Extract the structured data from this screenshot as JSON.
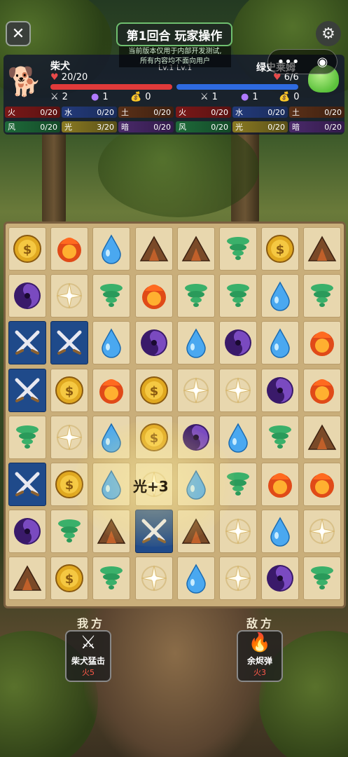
{
  "header": {
    "title": "第1回合 玩家操作",
    "notice_line1": "当前版本仅用于内部开发测试,",
    "notice_line2": "所有内容均不面向用户"
  },
  "player": {
    "name": "柴犬",
    "level": "Lv.1",
    "hp": "20/20",
    "hp_fraction": 1.0,
    "attack": "2",
    "magic": "1",
    "gold": "0",
    "elements": [
      {
        "name": "火",
        "value": "0/20",
        "cls": "e-fire"
      },
      {
        "name": "水",
        "value": "0/20",
        "cls": "e-water"
      },
      {
        "name": "土",
        "value": "0/20",
        "cls": "e-earth"
      },
      {
        "name": "风",
        "value": "0/20",
        "cls": "e-wind"
      },
      {
        "name": "光",
        "value": "3/20",
        "cls": "e-light"
      },
      {
        "name": "暗",
        "value": "0/20",
        "cls": "e-dark"
      }
    ]
  },
  "enemy": {
    "name": "绿史莱姆",
    "level": "Lv.1",
    "hp": "6/6",
    "hp_fraction": 1.0,
    "attack": "1",
    "magic": "1",
    "gold": "0",
    "elements": [
      {
        "name": "火",
        "value": "0/20",
        "cls": "e-fire"
      },
      {
        "name": "水",
        "value": "0/20",
        "cls": "e-water"
      },
      {
        "name": "土",
        "value": "0/20",
        "cls": "e-earth"
      },
      {
        "name": "风",
        "value": "0/20",
        "cls": "e-wind"
      },
      {
        "name": "光",
        "value": "0/20",
        "cls": "e-light"
      },
      {
        "name": "暗",
        "value": "0/20",
        "cls": "e-dark"
      }
    ]
  },
  "board": {
    "rows": [
      [
        "gold",
        "fire",
        "water",
        "earth",
        "earth",
        "wind",
        "gold",
        "earth"
      ],
      [
        "dark",
        "light",
        "wind",
        "fire",
        "wind",
        "wind",
        "water",
        "wind"
      ],
      [
        "sword",
        "sword",
        "water",
        "dark",
        "water",
        "dark",
        "water",
        "fire"
      ],
      [
        "sword",
        "gold",
        "fire",
        "gold",
        "light",
        "light",
        "dark",
        "fire"
      ],
      [
        "wind",
        "light",
        "water",
        "gold",
        "dark",
        "water",
        "wind",
        "earth"
      ],
      [
        "sword",
        "gold",
        "water",
        "light",
        "water",
        "wind",
        "fire",
        "fire"
      ],
      [
        "dark",
        "wind",
        "earth",
        "sword",
        "earth",
        "light",
        "water",
        "light"
      ],
      [
        "earth",
        "gold",
        "wind",
        "light",
        "water",
        "light",
        "dark",
        "wind"
      ]
    ],
    "combo_text": "光+3"
  },
  "bottom": {
    "my_side": "我方",
    "enemy_side": "敌方",
    "my_skill": {
      "name": "柴犬猛击",
      "cost": "火5"
    },
    "enemy_skill": {
      "name": "余烬弹",
      "cost": "火3"
    }
  }
}
